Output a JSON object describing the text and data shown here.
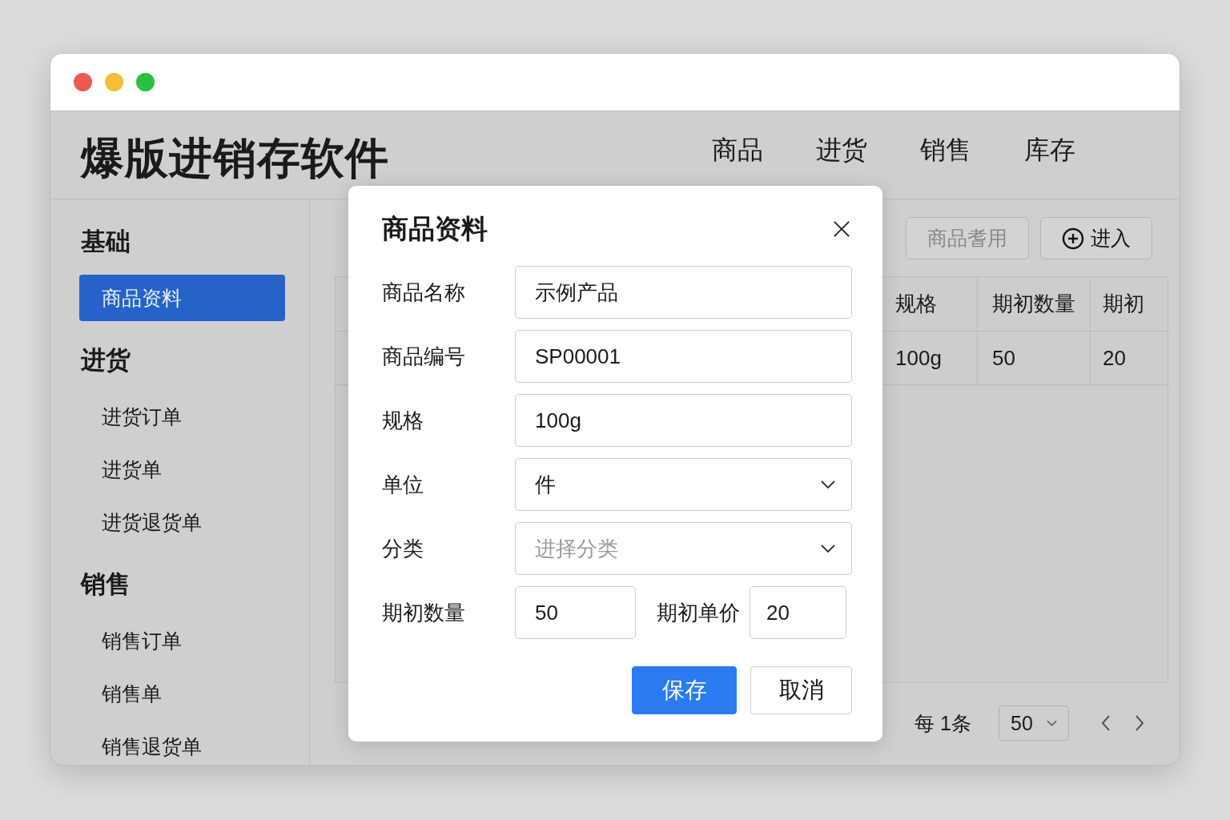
{
  "app_title": "爆版进销存软件",
  "nav": [
    {
      "label": "商品"
    },
    {
      "label": "进货"
    },
    {
      "label": "销售"
    },
    {
      "label": "库存"
    }
  ],
  "sidebar": {
    "sections": [
      {
        "title": "基础",
        "items": [
          {
            "label": "商品资料",
            "selected": true
          }
        ]
      },
      {
        "title": "进货",
        "items": [
          {
            "label": "进货订单",
            "selected": false
          },
          {
            "label": "进货单",
            "selected": false
          },
          {
            "label": "进货退货单",
            "selected": false
          }
        ]
      },
      {
        "title": "销售",
        "items": [
          {
            "label": "销售订单",
            "selected": false
          },
          {
            "label": "销售单",
            "selected": false
          },
          {
            "label": "销售退货单",
            "selected": false
          }
        ]
      }
    ]
  },
  "toolbar": {
    "buttons": [
      {
        "label": "商品耆用",
        "kind": "plain"
      },
      {
        "label": "进入",
        "kind": "add"
      }
    ]
  },
  "table": {
    "columns": [
      "规格",
      "期初数量",
      "期初"
    ],
    "rows": [
      [
        "100g",
        "50",
        "20"
      ]
    ]
  },
  "pagination": {
    "summary": "每 1条",
    "page_size": "50"
  },
  "dialog": {
    "title": "商品资料",
    "fields": [
      {
        "label": "商品名称",
        "kind": "text",
        "value": "示例产品"
      },
      {
        "label": "商品编号",
        "kind": "text",
        "value": "SP00001"
      },
      {
        "label": "规格",
        "kind": "text",
        "value": "100g"
      },
      {
        "label": "单位",
        "kind": "select",
        "value": "件"
      },
      {
        "label": "分类",
        "kind": "select",
        "placeholder": "进择分类"
      }
    ],
    "pair": [
      {
        "label": "期初数量",
        "value": "50"
      },
      {
        "label": "期初单价",
        "value": "20"
      }
    ],
    "buttons": [
      {
        "label": "保存",
        "kind": "primary"
      },
      {
        "label": "取消",
        "kind": "default"
      }
    ]
  }
}
